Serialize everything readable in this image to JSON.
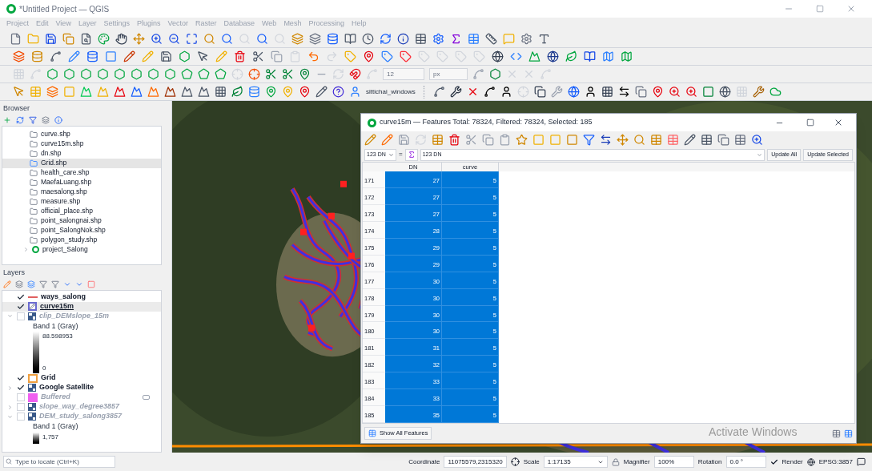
{
  "window": {
    "title": "*Untitled Project — QGIS"
  },
  "menu": [
    "Project",
    "Edit",
    "View",
    "Layer",
    "Settings",
    "Plugins",
    "Vector",
    "Raster",
    "Database",
    "Web",
    "Mesh",
    "Processing",
    "Help"
  ],
  "toolbar": {
    "size_value": "12",
    "size_unit": "px",
    "user": "sittichai_windows"
  },
  "browser": {
    "title": "Browser",
    "items": [
      {
        "name": "curve.shp",
        "kind": "file",
        "selected": false
      },
      {
        "name": "curve15m.shp",
        "kind": "file",
        "selected": false
      },
      {
        "name": "dn.shp",
        "kind": "file",
        "selected": false
      },
      {
        "name": "Grid.shp",
        "kind": "file",
        "selected": true
      },
      {
        "name": "health_care.shp",
        "kind": "file",
        "selected": false
      },
      {
        "name": "MaefaLuang.shp",
        "kind": "file",
        "selected": false
      },
      {
        "name": "maesalong.shp",
        "kind": "file",
        "selected": false
      },
      {
        "name": "measure.shp",
        "kind": "file",
        "selected": false
      },
      {
        "name": "official_place.shp",
        "kind": "file",
        "selected": false
      },
      {
        "name": "point_salongnai.shp",
        "kind": "file",
        "selected": false
      },
      {
        "name": "point_SalongNok.shp",
        "kind": "file",
        "selected": false
      },
      {
        "name": "polygon_study.shp",
        "kind": "file",
        "selected": false
      },
      {
        "name": "project_Salong",
        "kind": "project",
        "selected": false
      }
    ]
  },
  "layers": {
    "title": "Layers",
    "items": [
      {
        "name": "ways_salong",
        "kind": "line",
        "color": "#e06060",
        "checked": true,
        "selected": false
      },
      {
        "name": "curve15m",
        "kind": "edit",
        "color": "#6a6ad0",
        "checked": true,
        "selected": true
      },
      {
        "name": "clip_DEMslope_15m",
        "kind": "raster",
        "color": "#3a5a8a",
        "checked": false,
        "selected": false,
        "expanded": true,
        "legend": {
          "band": "Band 1 (Gray)",
          "max": "88.598953",
          "min": "0"
        }
      },
      {
        "name": "Grid",
        "kind": "polygon_outline",
        "color": "#f0a040",
        "checked": true,
        "selected": false
      },
      {
        "name": "Google Satellite",
        "kind": "raster",
        "color": "#3a5a8a",
        "checked": true,
        "selected": false,
        "expanded": false
      },
      {
        "name": "Buffered",
        "kind": "polygon_fill",
        "color": "#f060f0",
        "checked": false,
        "selected": false,
        "indicator": true
      },
      {
        "name": "slope_way_degree3857",
        "kind": "raster",
        "color": "#3a5a8a",
        "checked": false,
        "selected": false,
        "expanded": false
      },
      {
        "name": "DEM_study_salong3857",
        "kind": "raster",
        "color": "#3a5a8a",
        "checked": false,
        "selected": false,
        "expanded": true,
        "legend": {
          "band": "Band 1 (Gray)",
          "max": "1,757"
        }
      }
    ]
  },
  "locator": {
    "placeholder": "Type to locate (Ctrl+K)"
  },
  "attribute_table": {
    "title": "curve15m — Features Total: 78324, Filtered: 78324, Selected: 185",
    "field": {
      "type_label": "123",
      "name": "DN"
    },
    "equals": "=",
    "expression": {
      "type_label": "123",
      "name": "DN"
    },
    "buttons": [
      "Update All",
      "Update Selected"
    ],
    "columns": [
      "DN",
      "curve"
    ],
    "rows": [
      {
        "id": "171",
        "values": [
          "27",
          "5"
        ],
        "selected": true
      },
      {
        "id": "172",
        "values": [
          "27",
          "5"
        ],
        "selected": true
      },
      {
        "id": "173",
        "values": [
          "27",
          "5"
        ],
        "selected": true
      },
      {
        "id": "174",
        "values": [
          "28",
          "5"
        ],
        "selected": true
      },
      {
        "id": "175",
        "values": [
          "29",
          "5"
        ],
        "selected": true
      },
      {
        "id": "176",
        "values": [
          "29",
          "5"
        ],
        "selected": true
      },
      {
        "id": "177",
        "values": [
          "30",
          "5"
        ],
        "selected": true
      },
      {
        "id": "178",
        "values": [
          "30",
          "5"
        ],
        "selected": true
      },
      {
        "id": "179",
        "values": [
          "30",
          "5"
        ],
        "selected": true
      },
      {
        "id": "180",
        "values": [
          "30",
          "5"
        ],
        "selected": true
      },
      {
        "id": "181",
        "values": [
          "31",
          "5"
        ],
        "selected": true
      },
      {
        "id": "182",
        "values": [
          "32",
          "5"
        ],
        "selected": true
      },
      {
        "id": "183",
        "values": [
          "33",
          "5"
        ],
        "selected": true
      },
      {
        "id": "184",
        "values": [
          "33",
          "5"
        ],
        "selected": true
      },
      {
        "id": "185",
        "values": [
          "35",
          "5"
        ],
        "selected": true
      }
    ],
    "filter_button": "Show All Features"
  },
  "os_notice": "Activate Windows",
  "status_bar": {
    "coordinate_label": "Coordinate",
    "coordinate": "11075579,2315320",
    "scale_label": "Scale",
    "scale": "1:17135",
    "magnifier_label": "Magnifier",
    "magnifier": "100%",
    "rotation_label": "Rotation",
    "rotation": "0.0 °",
    "render_label": "Render",
    "render_checked": true,
    "crs": "EPSG:3857"
  }
}
